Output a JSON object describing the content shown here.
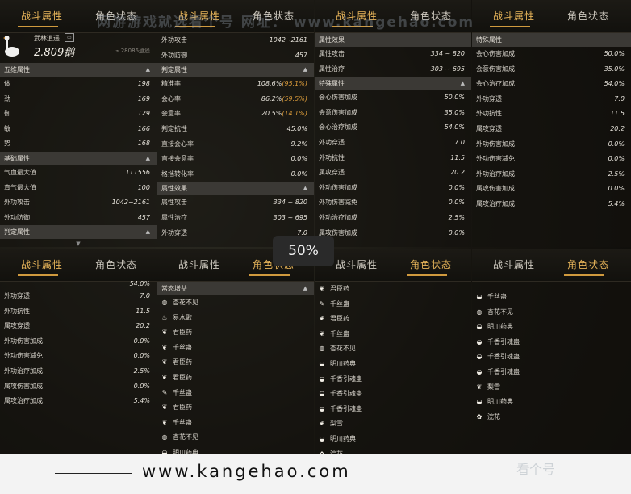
{
  "tabs": {
    "combat": "战斗属性",
    "role": "角色状态"
  },
  "watermark_top": "网游游戏就选看个号 网址： www.kangehao.com",
  "zoom_badge": "50%",
  "banner": {
    "url": "www.kangehao.com"
  },
  "watermark_corner": "看个号",
  "player": {
    "name": "武林逍遥",
    "id_icon": "id-card-icon",
    "value": "2.809鹅",
    "count": "28086逍遥"
  },
  "p1": {
    "sec_five": "五维属性",
    "five": [
      [
        "体",
        "198"
      ],
      [
        "劲",
        "169"
      ],
      [
        "御",
        "129"
      ],
      [
        "敏",
        "166"
      ],
      [
        "势",
        "168"
      ]
    ],
    "sec_base": "基础属性",
    "base": [
      [
        "气血最大值",
        "111556"
      ],
      [
        "真气最大值",
        "100"
      ],
      [
        "外功攻击",
        "1042~2161"
      ],
      [
        "外功防御",
        "457"
      ]
    ],
    "sec_judge": "判定属性"
  },
  "p2": {
    "top": [
      [
        "外功攻击",
        "1042~2161"
      ],
      [
        "外功防御",
        "457"
      ]
    ],
    "sec_judge": "判定属性",
    "judge": [
      [
        "精准率",
        "108.6%",
        "95.1%"
      ],
      [
        "会心率",
        "86.2%",
        "59.5%"
      ],
      [
        "会意率",
        "20.5%",
        "14.1%"
      ],
      [
        "判定抗性",
        "45.0%",
        ""
      ],
      [
        "直接会心率",
        "9.2%",
        ""
      ],
      [
        "直接会意率",
        "0.0%",
        ""
      ],
      [
        "格挡转化率",
        "0.0%",
        ""
      ]
    ],
    "sec_effect": "属性效果",
    "effect": [
      [
        "属性攻击",
        "334 ~ 820"
      ],
      [
        "属性治疗",
        "303 ~ 695"
      ],
      [
        "外功穿透",
        "7.0"
      ]
    ]
  },
  "p3": {
    "sec_effect": "属性效果",
    "effect": [
      [
        "属性攻击",
        "334 ~ 820"
      ],
      [
        "属性治疗",
        "303 ~ 695"
      ]
    ],
    "sec_special": "特殊属性",
    "special": [
      [
        "会心伤害加成",
        "50.0%"
      ],
      [
        "会意伤害加成",
        "35.0%"
      ],
      [
        "会心治疗加成",
        "54.0%"
      ],
      [
        "外功穿透",
        "7.0"
      ],
      [
        "外功抗性",
        "11.5"
      ],
      [
        "属攻穿透",
        "20.2"
      ],
      [
        "外功伤害加成",
        "0.0%"
      ],
      [
        "外功伤害减免",
        "0.0%"
      ],
      [
        "外功治疗加成",
        "2.5%"
      ],
      [
        "属攻伤害加成",
        "0.0%"
      ]
    ]
  },
  "p4": {
    "sec_special": "特殊属性",
    "special": [
      [
        "会心伤害加成",
        "50.0%"
      ],
      [
        "会意伤害加成",
        "35.0%"
      ],
      [
        "会心治疗加成",
        "54.0%"
      ],
      [
        "外功穿透",
        "7.0"
      ],
      [
        "外功抗性",
        "11.5"
      ],
      [
        "属攻穿透",
        "20.2"
      ],
      [
        "外功伤害加成",
        "0.0%"
      ],
      [
        "外功伤害减免",
        "0.0%"
      ],
      [
        "外功治疗加成",
        "2.5%"
      ],
      [
        "属攻伤害加成",
        "0.0%"
      ],
      [
        "属攻治疗加成",
        "5.4%"
      ]
    ]
  },
  "p5": {
    "partial": "54.0%",
    "rows": [
      [
        "外功穿透",
        "7.0"
      ],
      [
        "外功抗性",
        "11.5"
      ],
      [
        "属攻穿透",
        "20.2"
      ],
      [
        "外功伤害加成",
        "0.0%"
      ],
      [
        "外功伤害减免",
        "0.0%"
      ],
      [
        "外功治疗加成",
        "2.5%"
      ],
      [
        "属攻伤害加成",
        "0.0%"
      ],
      [
        "属攻治疗加成",
        "5.4%"
      ]
    ]
  },
  "p6": {
    "sec": "常态增益",
    "items": [
      [
        "drop-icon",
        "杏花不见"
      ],
      [
        "flame-icon",
        "易水歌"
      ],
      [
        "leaf-icon",
        "君臣药"
      ],
      [
        "leaf-icon",
        "千丝蛊"
      ],
      [
        "leaf-icon",
        "君臣药"
      ],
      [
        "leaf-icon",
        "君臣药"
      ],
      [
        "brush-icon",
        "千丝蛊"
      ],
      [
        "leaf-icon",
        "君臣药"
      ],
      [
        "leaf-icon",
        "千丝蛊"
      ],
      [
        "drop-icon",
        "杏花不见"
      ],
      [
        "bowl-icon",
        "明川药典"
      ]
    ]
  },
  "p7": {
    "items": [
      [
        "leaf-icon",
        "君臣药"
      ],
      [
        "brush-icon",
        "千丝蛊"
      ],
      [
        "leaf-icon",
        "君臣药"
      ],
      [
        "leaf-icon",
        "千丝蛊"
      ],
      [
        "drop-icon",
        "杏花不见"
      ],
      [
        "bowl-icon",
        "明川药典"
      ],
      [
        "bowl-icon",
        "千香引魂蛊"
      ],
      [
        "bowl-icon",
        "千香引魂蛊"
      ],
      [
        "bowl-icon",
        "千香引魂蛊"
      ],
      [
        "leaf-icon",
        "梨雪"
      ],
      [
        "bowl-icon",
        "明川药典"
      ],
      [
        "flower-icon",
        "浣花"
      ]
    ]
  },
  "p8": {
    "items": [
      [
        "bowl-icon",
        "千丝蛊"
      ],
      [
        "drop-icon",
        "杏花不见"
      ],
      [
        "bowl-icon",
        "明川药典"
      ],
      [
        "bowl-icon",
        "千香引魂蛊"
      ],
      [
        "bowl-icon",
        "千香引魂蛊"
      ],
      [
        "bowl-icon",
        "千香引魂蛊"
      ],
      [
        "leaf-icon",
        "梨雪"
      ],
      [
        "bowl-icon",
        "明川药典"
      ],
      [
        "flower-icon",
        "浣花"
      ]
    ]
  }
}
